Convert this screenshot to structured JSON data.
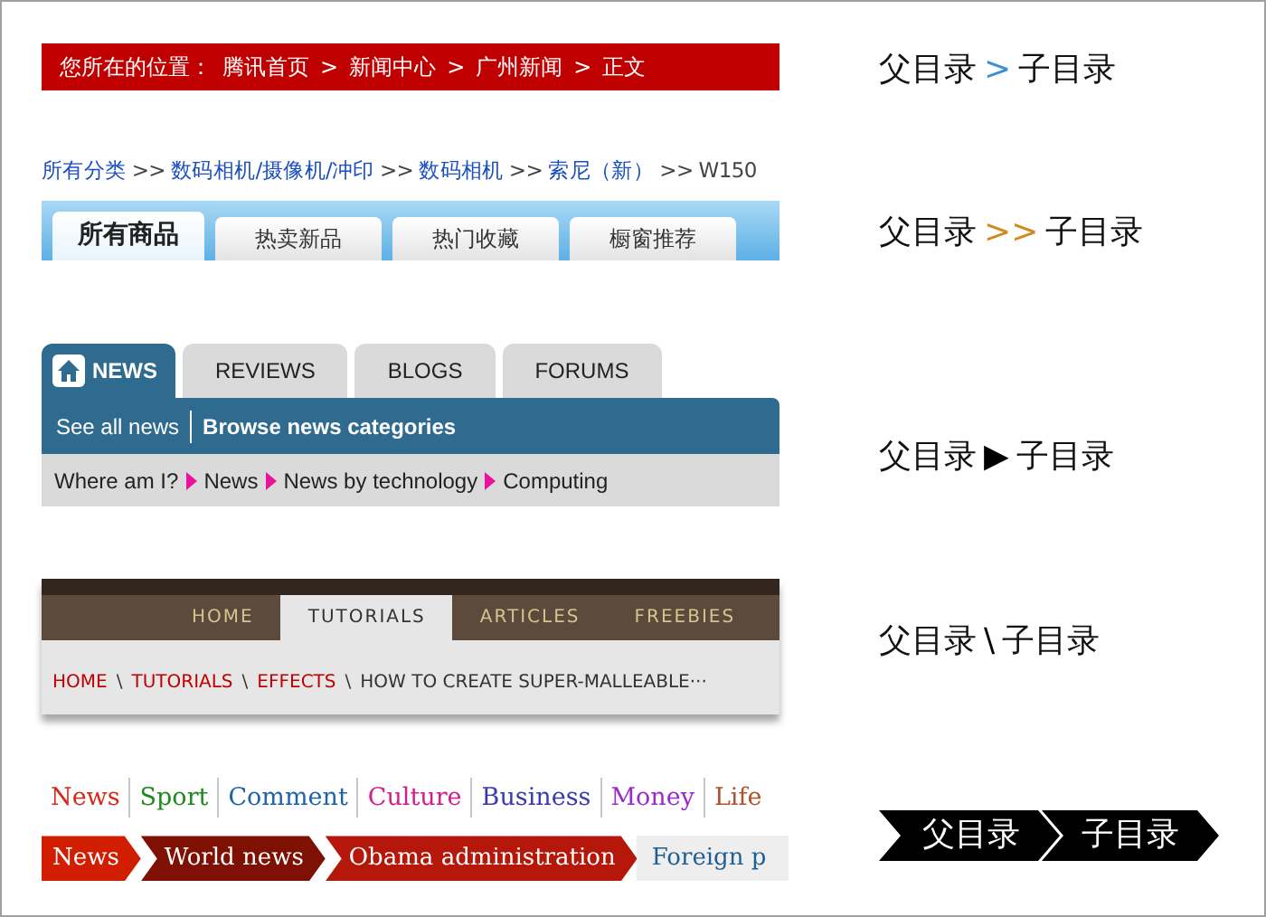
{
  "location_bar": {
    "label": "您所在的位置：",
    "separator": ">",
    "items": [
      "腾讯首页",
      "新闻中心",
      "广州新闻",
      "正文"
    ]
  },
  "category_path": {
    "separator": ">>",
    "items": [
      {
        "text": "所有分类",
        "kind": "link"
      },
      {
        "text": "数码相机/摄像机/冲印",
        "kind": "link"
      },
      {
        "text": "数码相机",
        "kind": "link"
      },
      {
        "text": "索尼（新）",
        "kind": "link"
      },
      {
        "text": "W150",
        "kind": "current"
      }
    ]
  },
  "product_tabs": [
    {
      "label": "所有商品",
      "selected": true
    },
    {
      "label": "热卖新品",
      "selected": false
    },
    {
      "label": "热门收藏",
      "selected": false
    },
    {
      "label": "橱窗推荐",
      "selected": false
    }
  ],
  "news_nav": {
    "tabs": [
      {
        "label": "NEWS",
        "selected": true
      },
      {
        "label": "REVIEWS",
        "selected": false
      },
      {
        "label": "BLOGS",
        "selected": false
      },
      {
        "label": "FORUMS",
        "selected": false
      }
    ],
    "sub_links": [
      {
        "text": "See all news",
        "selected": false
      },
      {
        "text": "Browse news categories",
        "selected": true
      }
    ],
    "where_label": "Where am I?",
    "crumbs": [
      "News",
      "News by technology",
      "Computing"
    ]
  },
  "tutorial_nav": {
    "tabs": [
      {
        "label": "HOME",
        "selected": false
      },
      {
        "label": "TUTORIALS",
        "selected": true
      },
      {
        "label": "ARTICLES",
        "selected": false
      },
      {
        "label": "FREEBIES",
        "selected": false
      }
    ],
    "separator": "\\",
    "crumbs": [
      {
        "text": "HOME",
        "kind": "link"
      },
      {
        "text": "TUTORIALS",
        "kind": "link"
      },
      {
        "text": "EFFECTS",
        "kind": "link"
      },
      {
        "text": "HOW TO CREATE SUPER-MALLEABLE···",
        "kind": "current"
      }
    ]
  },
  "section_links": [
    {
      "text": "News",
      "color": "#d42a1a"
    },
    {
      "text": "Sport",
      "color": "#1e8a1e"
    },
    {
      "text": "Comment",
      "color": "#1f63a8"
    },
    {
      "text": "Culture",
      "color": "#d21e8c"
    },
    {
      "text": "Business",
      "color": "#3a3ab0"
    },
    {
      "text": "Money",
      "color": "#9a2ccf"
    },
    {
      "text": "Life",
      "color": "#b0512a"
    }
  ],
  "chevron_crumbs": [
    {
      "text": "News",
      "color": "#d21e00",
      "kind": "link"
    },
    {
      "text": "World news",
      "color": "#7e1104",
      "kind": "link"
    },
    {
      "text": "Obama administration",
      "color": "#b5170a",
      "kind": "link"
    },
    {
      "text": "Foreign p",
      "color": "#eeeeee",
      "kind": "more"
    }
  ],
  "examples": [
    {
      "kind": "text",
      "parent": "父目录",
      "separator": ">",
      "color": "#3b8fd3",
      "child": "子目录"
    },
    {
      "kind": "text",
      "parent": "父目录",
      "separator": ">>",
      "color": "#d08a1e",
      "child": "子目录"
    },
    {
      "kind": "text",
      "parent": "父目录",
      "separator": "▶",
      "color": "#000000",
      "child": "子目录"
    },
    {
      "kind": "text",
      "parent": "父目录",
      "separator": "\\",
      "color": "#000000",
      "child": "子目录"
    },
    {
      "kind": "chevron",
      "parent": "父目录",
      "child": "子目录"
    }
  ]
}
